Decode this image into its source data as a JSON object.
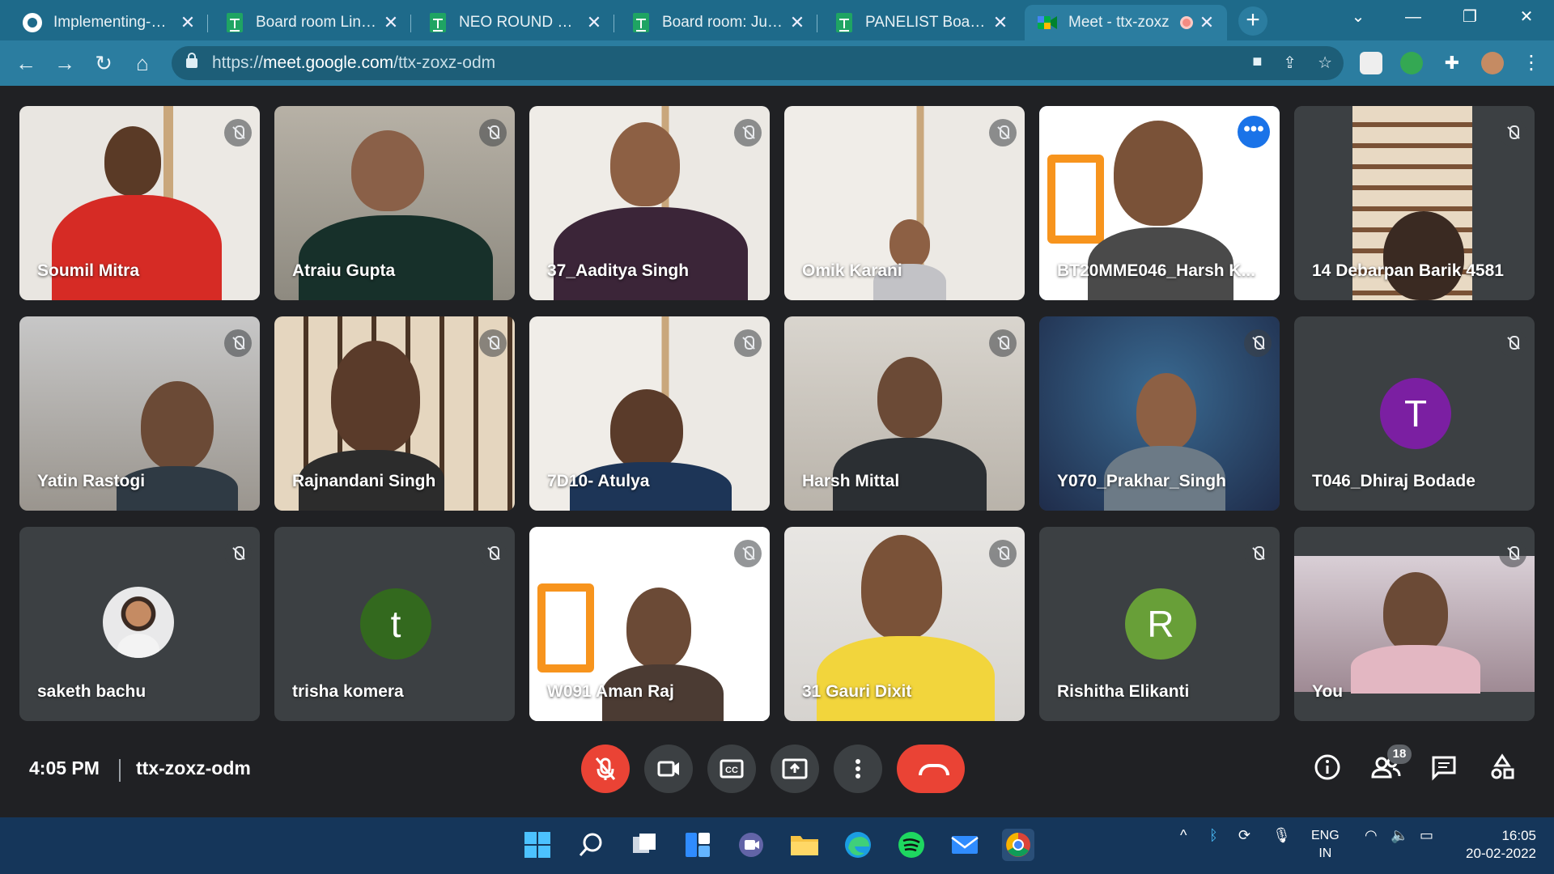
{
  "browser": {
    "tabs": [
      {
        "title": "Implementing-Big-",
        "icon": "github-icon"
      },
      {
        "title": "Board room Links -",
        "icon": "sheets-icon"
      },
      {
        "title": "NEO ROUND 3 PAR",
        "icon": "sheets-icon"
      },
      {
        "title": "Board room: Judge",
        "icon": "sheets-icon"
      },
      {
        "title": "PANELIST Board roo",
        "icon": "sheets-icon"
      },
      {
        "title": "Meet - ttx-zoxz",
        "icon": "meet-icon"
      }
    ],
    "url_prefix": "https://",
    "url_host": "meet.google.com",
    "url_path": "/ttx-zoxz-odm"
  },
  "meet": {
    "participants": [
      {
        "name": "Soumil Mitra"
      },
      {
        "name": "Atraiu Gupta"
      },
      {
        "name": "37_Aaditya Singh"
      },
      {
        "name": "Omik Karani"
      },
      {
        "name": "BT20MME046_Harsh K..."
      },
      {
        "name": "14 Debarpan Barik 4581"
      },
      {
        "name": "Yatin Rastogi"
      },
      {
        "name": "Rajnandani Singh"
      },
      {
        "name": "7D10- Atulya"
      },
      {
        "name": "Harsh Mittal"
      },
      {
        "name": "Y070_Prakhar_Singh"
      },
      {
        "name": "T046_Dhiraj Bodade",
        "initial": "T",
        "color": "#7b1fa2"
      },
      {
        "name": "saketh bachu"
      },
      {
        "name": "trisha komera",
        "initial": "t",
        "color": "#33691e"
      },
      {
        "name": "W091 Aman Raj"
      },
      {
        "name": "31 Gauri Dixit"
      },
      {
        "name": "Rishitha Elikanti",
        "initial": "R",
        "color": "#689f38"
      },
      {
        "name": "You"
      }
    ],
    "time": "4:05 PM",
    "meeting_code": "ttx-zoxz-odm",
    "people_count": "18"
  },
  "taskbar": {
    "lang_top": "ENG",
    "lang_bottom": "IN",
    "clock_time": "16:05",
    "clock_date": "20-02-2022"
  }
}
